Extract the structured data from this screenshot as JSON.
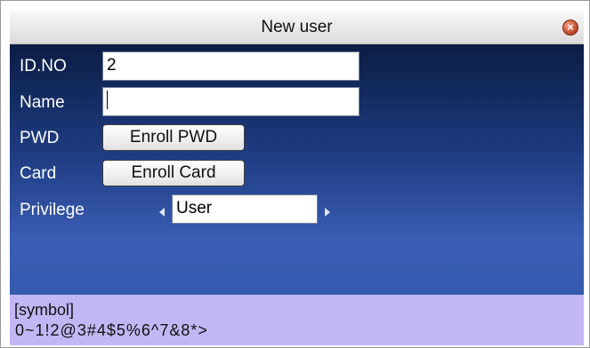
{
  "window": {
    "title": "New user",
    "close_icon": "close-icon",
    "close_glyph": "×"
  },
  "form": {
    "id_label": "ID.NO",
    "id_value": "2",
    "name_label": "Name",
    "name_value": "",
    "pwd_label": "PWD",
    "pwd_button": "Enroll PWD",
    "card_label": "Card",
    "card_button": "Enroll Card",
    "privilege_label": "Privilege",
    "privilege_value": "User"
  },
  "symbol_bar": {
    "label": "[symbol]",
    "chars": "0~1!2@3#4$5%6^7&8*>"
  },
  "colors": {
    "content_top": "#0b1d44",
    "content_bottom": "#355aae",
    "symbol_bar": "#c2b7f4",
    "close_button": "#c0472a"
  }
}
